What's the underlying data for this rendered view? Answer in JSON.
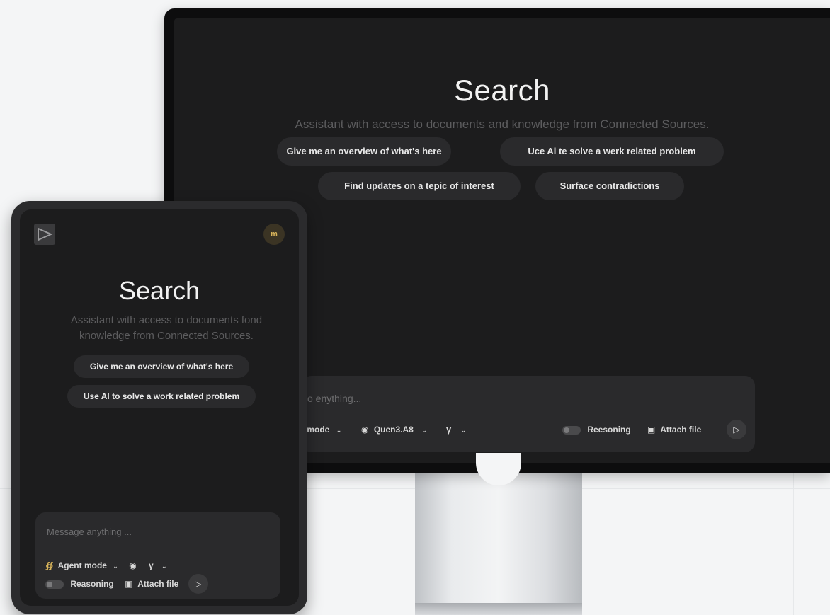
{
  "desktop": {
    "title": "Search",
    "subtitle": "Assistant with access to documents and knowledge from Connected Sources.",
    "suggestions": [
      "Give me an overview of what's here",
      "Uce Al te solve a werk related problem",
      "Find updates on a tepic of interest",
      "Surface contradictions"
    ],
    "input": {
      "placeholder": "o enything...",
      "mode_label": "t mode",
      "model_label": "Quen3.A8",
      "reasoning_label": "Reesoning",
      "attach_label": "Attach file"
    }
  },
  "tablet": {
    "avatar_initials": "m",
    "title": "Search",
    "subtitle": "Assistant with access to documents fond knowledge from Connected Sources.",
    "suggestions": [
      "Give me an overview of what's here",
      "Use Al to solve a work related problem"
    ],
    "input": {
      "placeholder": "Message anything ...",
      "mode_label": "Agent mode",
      "reasoning_label": "Reasoning",
      "attach_label": "Attach file"
    }
  },
  "icons": {
    "send": "send-icon",
    "chevron": "chevron-down-icon",
    "filter": "filter-icon",
    "globe": "globe-icon",
    "attach": "attach-icon",
    "agent": "agent-icon"
  }
}
